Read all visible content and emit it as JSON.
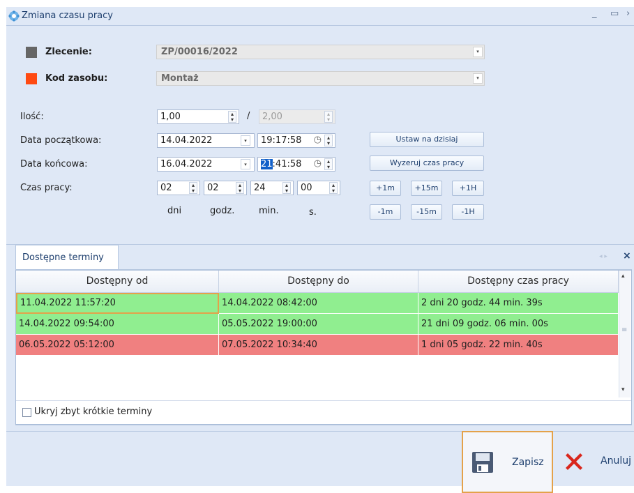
{
  "window": {
    "title": "Zmiana czasu pracy",
    "minimize_glyph": "_",
    "maximize_glyph": "▭",
    "close_glyph": "›"
  },
  "order": {
    "label": "Zlecenie:",
    "value": "ZP/00016/2022",
    "color": "#666666"
  },
  "resource": {
    "label": "Kod zasobu:",
    "value": "Montaż",
    "color": "#ff4a12"
  },
  "quantity": {
    "label": "Ilość:",
    "value": "1,00",
    "separator": "/",
    "max_value": "2,00"
  },
  "start": {
    "label": "Data początkowa:",
    "date": "14.04.2022",
    "time": "19:17:58"
  },
  "end": {
    "label": "Data końcowa:",
    "date": "16.04.2022",
    "time_selected": "21",
    "time_rest": ":41:58"
  },
  "worktime": {
    "label": "Czas pracy:",
    "days": "02",
    "hours": "02",
    "minutes": "24",
    "seconds": "00",
    "units": {
      "days": "dni",
      "hours": "godz.",
      "minutes": "min.",
      "seconds": "s."
    }
  },
  "buttons": {
    "set_today": "Ustaw na dzisiaj",
    "reset_time": "Wyzeruj czas pracy",
    "plus_1m": "+1m",
    "plus_15m": "+15m",
    "plus_1h": "+1H",
    "minus_1m": "-1m",
    "minus_15m": "-15m",
    "minus_1h": "-1H"
  },
  "panel": {
    "tab": "Dostępne terminy",
    "nav_glyphs": "◂ ▸",
    "close_glyph": "×",
    "columns": [
      "Dostępny od",
      "Dostępny do",
      "Dostępny czas pracy"
    ],
    "rows": [
      {
        "from": "11.04.2022 11:57:20",
        "to": "14.04.2022 08:42:00",
        "duration": "2 dni 20 godz. 44 min. 39s",
        "status": "green"
      },
      {
        "from": "14.04.2022 09:54:00",
        "to": "05.05.2022 19:00:00",
        "duration": "21 dni 09 godz. 06 min. 00s",
        "status": "green"
      },
      {
        "from": "06.05.2022 05:12:00",
        "to": "07.05.2022 10:34:40",
        "duration": "1 dni 05 godz. 22 min. 40s",
        "status": "red"
      }
    ],
    "hide_short": "Ukryj zbyt krótkie terminy",
    "hide_short_checked": false
  },
  "footer": {
    "save": "Zapisz",
    "cancel": "Anuluj"
  },
  "colors": {
    "green": "#90ee90",
    "red": "#f08080",
    "accent": "#1160c9"
  }
}
